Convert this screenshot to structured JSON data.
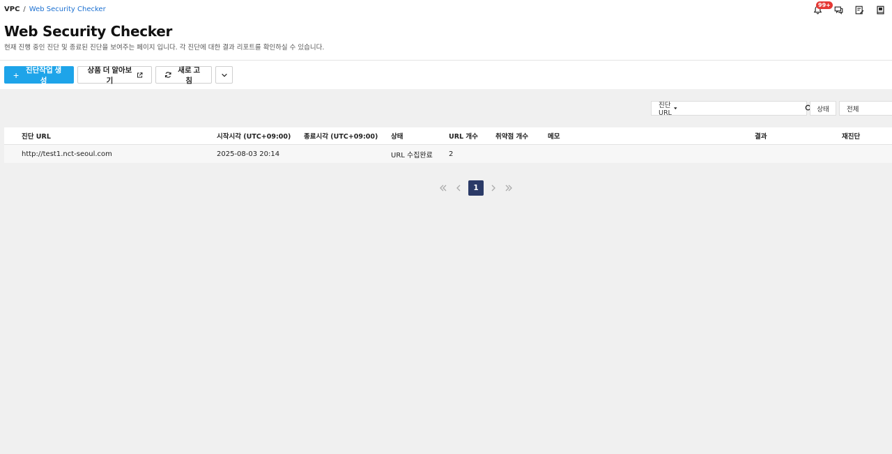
{
  "breadcrumb": {
    "root": "VPC",
    "separator": "/",
    "current": "Web Security Checker"
  },
  "notifications": {
    "badge": "99+"
  },
  "page": {
    "title": "Web Security Checker",
    "subtitle": "현재 진행 중인 진단 및 종료된 진단을 보여주는 페이지 입니다. 각 진단에 대한 결과 리포트를 확인하실 수 있습니다."
  },
  "toolbar": {
    "create_label": "진단작업 생성",
    "learn_more_label": "상품 더 알아보기",
    "refresh_label": "새로 고침"
  },
  "filter": {
    "field_selected": "진단 URL",
    "search_placeholder": "",
    "state_label": "상태",
    "state_selected": "전체"
  },
  "table": {
    "headers": {
      "url": "진단 URL",
      "start": "시작시각 (UTC+09:00)",
      "end": "종료시각 (UTC+09:00)",
      "state": "상태",
      "url_count": "URL 개수",
      "vuln_count": "취약점 개수",
      "memo": "메모",
      "result": "결과",
      "rescan": "재진단"
    },
    "rows": [
      {
        "url": "http://test1.nct-seoul.com",
        "start": "2025-08-03 20:14",
        "end": "",
        "state": "URL 수집완료",
        "url_count": "2",
        "vuln_count": "",
        "memo": "",
        "result": "",
        "rescan": ""
      }
    ]
  },
  "pagination": {
    "current": "1"
  },
  "colors": {
    "primary": "#1ea4e9",
    "page_active": "#2b3a67",
    "link": "#1a6fd1",
    "badge": "#e53935"
  }
}
